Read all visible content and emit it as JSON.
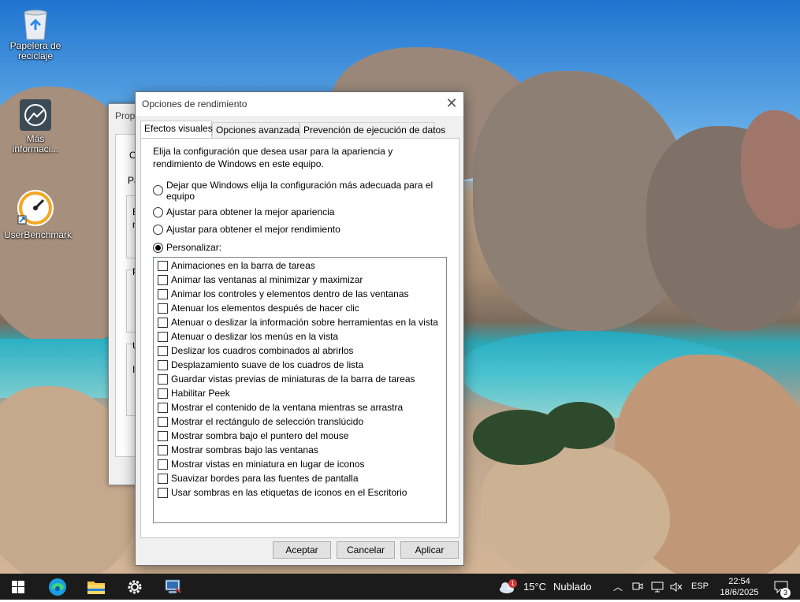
{
  "desktop": {
    "icons": [
      {
        "label": "Papelera de reciclaje",
        "icon": "recycle-bin-icon"
      },
      {
        "label": "Más informaci...",
        "icon": "info-icon"
      },
      {
        "label": "UserBenchmark",
        "icon": "gauge-icon"
      }
    ]
  },
  "back_window": {
    "title": "Prop",
    "labels": [
      "O",
      "Pa",
      "E",
      "n",
      "P",
      "U",
      "In"
    ]
  },
  "dialog": {
    "title": "Opciones de rendimiento",
    "close_label": "✕",
    "tabs": [
      {
        "label": "Efectos visuales",
        "active": true
      },
      {
        "label": "Opciones avanzadas",
        "active": false
      },
      {
        "label": "Prevención de ejecución de datos",
        "active": false
      }
    ],
    "intro": "Elija la configuración que desea usar para la apariencia y rendimiento de Windows en este equipo.",
    "radios": [
      {
        "label": "Dejar que Windows elija la configuración más adecuada para el",
        "label2": "equipo",
        "checked": false
      },
      {
        "label": "Ajustar para obtener la mejor apariencia",
        "checked": false
      },
      {
        "label": "Ajustar para obtener el mejor rendimiento",
        "checked": false
      },
      {
        "label": "Personalizar:",
        "checked": true
      }
    ],
    "options": [
      {
        "label": "Animaciones en la barra de tareas",
        "checked": false
      },
      {
        "label": "Animar las ventanas al minimizar y maximizar",
        "checked": false
      },
      {
        "label": "Animar los controles y elementos dentro de las ventanas",
        "checked": false
      },
      {
        "label": "Atenuar los elementos después de hacer clic",
        "checked": false
      },
      {
        "label": "Atenuar o deslizar la información sobre herramientas en la vista",
        "checked": false
      },
      {
        "label": "Atenuar o deslizar los menús en la vista",
        "checked": false
      },
      {
        "label": "Deslizar los cuadros combinados al abrirlos",
        "checked": false
      },
      {
        "label": "Desplazamiento suave de los cuadros de lista",
        "checked": false
      },
      {
        "label": "Guardar vistas previas de miniaturas de la barra de tareas",
        "checked": false
      },
      {
        "label": "Habilitar Peek",
        "checked": false
      },
      {
        "label": "Mostrar el contenido de la ventana mientras se arrastra",
        "checked": false
      },
      {
        "label": "Mostrar el rectángulo de selección translúcido",
        "checked": false
      },
      {
        "label": "Mostrar sombra bajo el puntero del mouse",
        "checked": false
      },
      {
        "label": "Mostrar sombras bajo las ventanas",
        "checked": false
      },
      {
        "label": "Mostrar vistas en miniatura en lugar de iconos",
        "checked": false
      },
      {
        "label": "Suavizar bordes para las fuentes de pantalla",
        "checked": false
      },
      {
        "label": "Usar sombras en las etiquetas de iconos en el Escritorio",
        "checked": false
      }
    ],
    "buttons": {
      "accept": "Aceptar",
      "cancel": "Cancelar",
      "apply": "Aplicar"
    }
  },
  "taskbar": {
    "weather": {
      "badge": "1",
      "temp": "15°C",
      "desc": "Nublado"
    },
    "language": "ESP",
    "time": "22:54",
    "date": "18/6/2025",
    "notifications": "3",
    "colors": {
      "bar": "#1b1b1b",
      "accent": "#0078d7"
    }
  }
}
